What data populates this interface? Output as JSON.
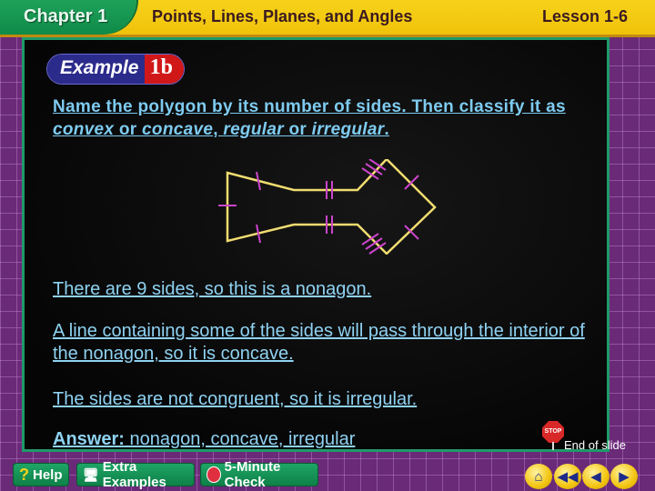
{
  "header": {
    "chapter": "Chapter 1",
    "title": "Points, Lines, Planes, and Angles",
    "lesson": "Lesson 1-6"
  },
  "example": {
    "word": "Example",
    "number": "1b"
  },
  "question": {
    "part1": "Name the polygon by its number of sides. Then classify it as ",
    "convex": "convex",
    "or1": " or ",
    "concave": "concave",
    "comma": ", ",
    "regular": "regular",
    "or2": " or ",
    "irregular": "irregular",
    "end": "."
  },
  "figure": {
    "shape": "nonagon",
    "stroke_color": "#f0dc70",
    "tick_color": "#cc44cc"
  },
  "body": [
    "There are 9 sides, so this is a nonagon.",
    "A line containing some of the sides will pass through the interior of the nonagon, so it is concave.",
    "The sides are not congruent, so it is irregular."
  ],
  "answer": {
    "label": "Answer:",
    "text": " nonagon, concave, irregular"
  },
  "end_of_slide": {
    "stop_label": "STOP",
    "text": "End of slide"
  },
  "bottom_nav": {
    "help": "Help",
    "extra_examples": "Extra Examples",
    "five_minute_check": "5-Minute Check"
  },
  "colors": {
    "header": "#f2c40f",
    "chapter_tab": "#149a52",
    "frame": "#6a2a78",
    "board_border": "#1f9a68",
    "text": "#8fd2f2"
  }
}
